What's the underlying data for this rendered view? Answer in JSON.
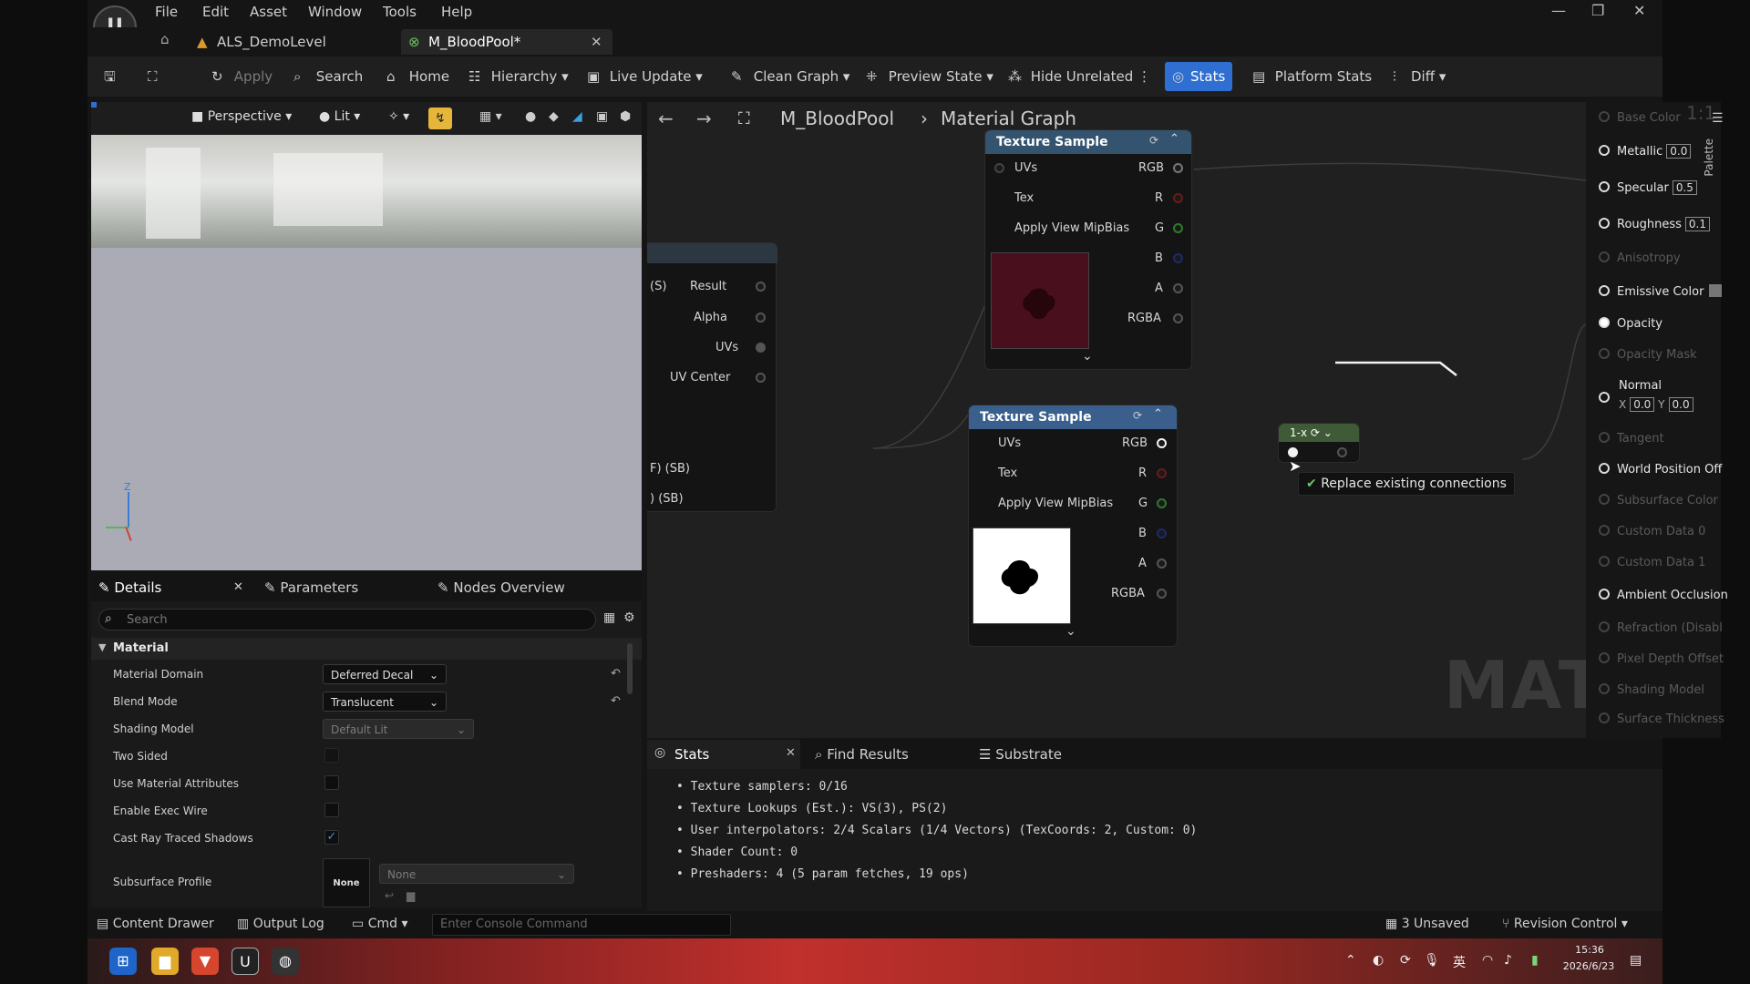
{
  "menu": [
    "File",
    "Edit",
    "Asset",
    "Window",
    "Tools",
    "Help"
  ],
  "tabs": [
    {
      "label": "ALS_DemoLevel"
    },
    {
      "label": "M_BloodPool*"
    }
  ],
  "toolbar": {
    "apply": "Apply",
    "search": "Search",
    "home": "Home",
    "hierarchy": "Hierarchy",
    "live_update": "Live Update",
    "clean_graph": "Clean Graph",
    "preview_state": "Preview State",
    "hide_unrelated": "Hide Unrelated",
    "stats": "Stats",
    "platform_stats": "Platform Stats",
    "diff": "Diff"
  },
  "viewport": {
    "perspective": "Perspective",
    "lit": "Lit"
  },
  "details": {
    "tabs": [
      "Details",
      "Parameters",
      "Nodes Overview"
    ],
    "search_placeholder": "Search",
    "section": "Material",
    "properties": [
      {
        "label": "Material Domain",
        "value": "Deferred Decal"
      },
      {
        "label": "Blend Mode",
        "value": "Translucent"
      },
      {
        "label": "Shading Model",
        "value": "Default Lit"
      },
      {
        "label": "Two Sided",
        "checked": false
      },
      {
        "label": "Use Material Attributes",
        "checked": false
      },
      {
        "label": "Enable Exec Wire",
        "checked": false
      },
      {
        "label": "Cast Ray Traced Shadows",
        "checked": true
      },
      {
        "label": "Subsurface Profile",
        "thumb": "None",
        "value": "None"
      }
    ]
  },
  "graph": {
    "breadcrumb_root": "M_BloodPool",
    "breadcrumb_leaf": "Material Graph",
    "watermark": "MATERIAL",
    "left_node_pins": [
      "Result",
      "Alpha",
      "UVs",
      "UV Center"
    ],
    "left_node_partial": [
      "(S)",
      "F) (SB)",
      ") (SB)"
    ],
    "texture_node_1": {
      "title": "Texture Sample",
      "inputs": [
        "UVs",
        "Tex",
        "Apply View MipBias"
      ],
      "outputs": [
        "RGB",
        "R",
        "G",
        "B",
        "A",
        "RGBA"
      ]
    },
    "texture_node_2": {
      "title": "Texture Sample",
      "inputs": [
        "UVs",
        "Tex",
        "Apply View MipBias"
      ],
      "outputs": [
        "RGB",
        "R",
        "G",
        "B",
        "A",
        "RGBA"
      ]
    },
    "oneminus_node": "1-x",
    "tooltip": "Replace existing connections"
  },
  "outputs": {
    "palette": "Palette",
    "rows": [
      {
        "label": "Base Color",
        "active": false
      },
      {
        "label": "Metallic",
        "active": true,
        "value": "0.0"
      },
      {
        "label": "Specular",
        "active": true,
        "value": "0.5"
      },
      {
        "label": "Roughness",
        "active": true,
        "value": "0.1"
      },
      {
        "label": "Anisotropy",
        "active": false
      },
      {
        "label": "Emissive Color",
        "active": true
      },
      {
        "label": "Opacity",
        "active": true
      },
      {
        "label": "Opacity Mask",
        "active": false
      },
      {
        "label": "Normal",
        "active": true,
        "x_label": "X",
        "x": "0.0",
        "y_label": "Y",
        "y": "0.0"
      },
      {
        "label": "Tangent",
        "active": false
      },
      {
        "label": "World Position Off",
        "active": true
      },
      {
        "label": "Subsurface Color",
        "active": false
      },
      {
        "label": "Custom Data 0",
        "active": false
      },
      {
        "label": "Custom Data 1",
        "active": false
      },
      {
        "label": "Ambient Occlusion",
        "active": true
      },
      {
        "label": "Refraction (Disabl",
        "active": false
      },
      {
        "label": "Pixel Depth Offset",
        "active": false
      },
      {
        "label": "Shading Model",
        "active": false
      },
      {
        "label": "Surface Thickness",
        "active": false
      }
    ]
  },
  "stats_panel": {
    "tabs": [
      "Stats",
      "Find Results",
      "Substrate"
    ],
    "lines": [
      "Texture samplers: 0/16",
      "Texture Lookups (Est.): VS(3), PS(2)",
      "User interpolators: 2/4 Scalars (1/4 Vectors) (TexCoords: 2, Custom: 0)",
      "Shader Count: 0",
      "Preshaders: 4  (5 param fetches, 19 ops)"
    ]
  },
  "statusbar": {
    "content_drawer": "Content Drawer",
    "output_log": "Output Log",
    "cmd": "Cmd",
    "console_placeholder": "Enter Console Command",
    "unsaved": "3 Unsaved",
    "revision_control": "Revision Control"
  },
  "taskbar": {
    "time": "15:36",
    "date": "2026/6/23",
    "ime": "英"
  },
  "colors": {
    "stats_accent": "#2f6fd1",
    "node_header": "#3a5f8c",
    "blood_preview": "#4a0f1c",
    "oneminus_header": "#3f5a36"
  }
}
